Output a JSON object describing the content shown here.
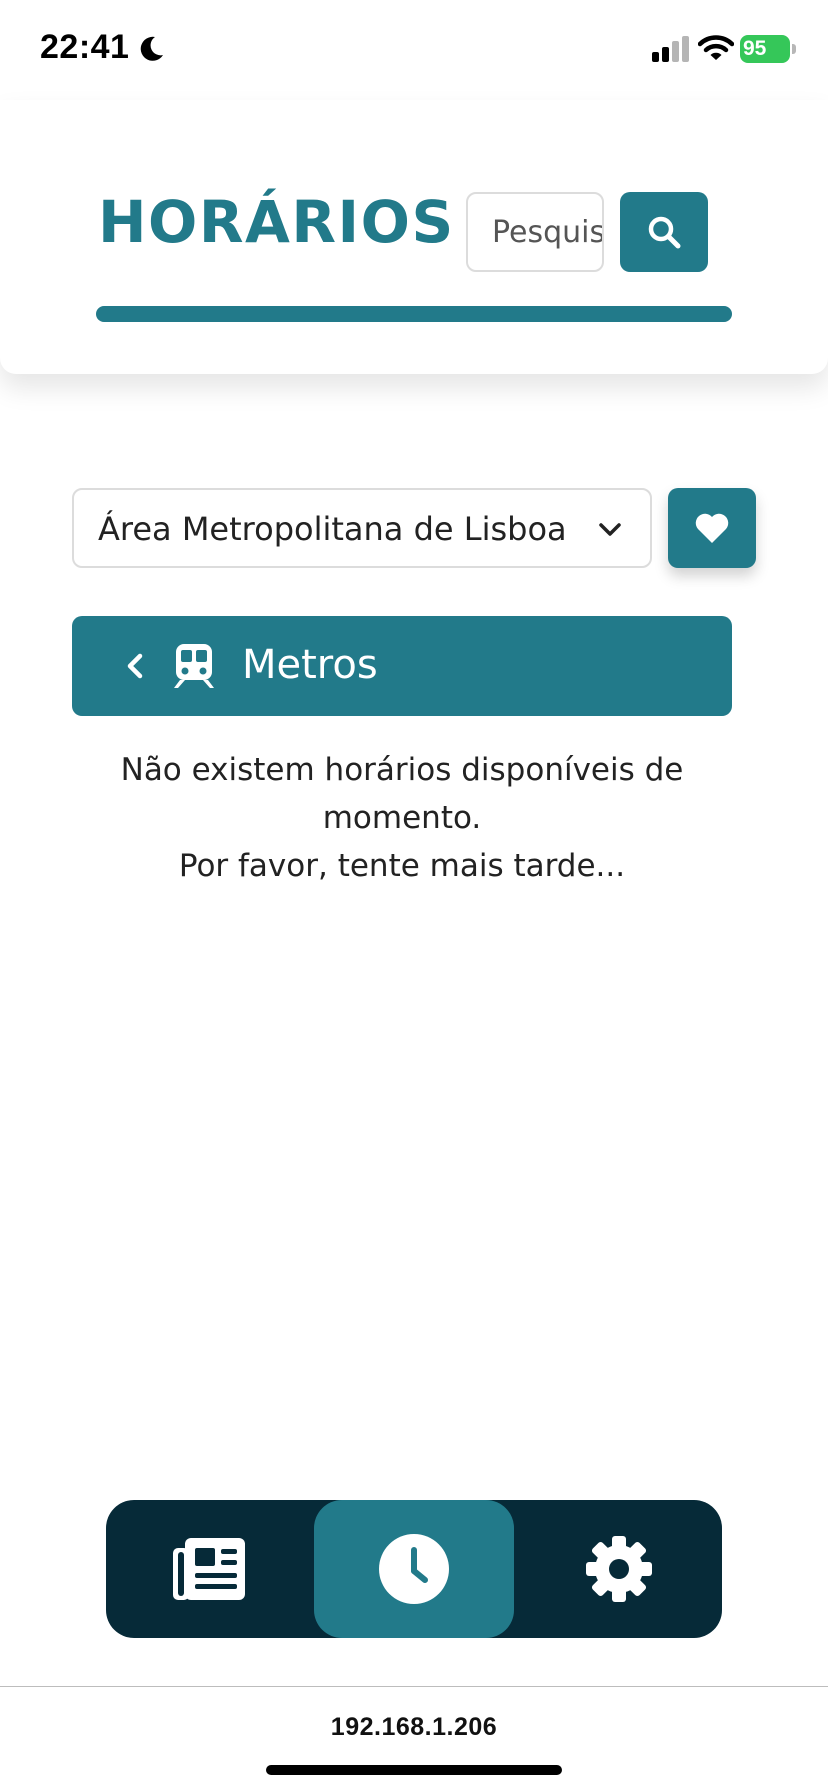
{
  "status_bar": {
    "time": "22:41",
    "battery": "95"
  },
  "header": {
    "title": "HORÁRIOS",
    "search_placeholder": "Pesquisar",
    "search_icon": "search-icon"
  },
  "region": {
    "selected": "Área Metropolitana de Lisboa",
    "favorite_icon": "heart-icon"
  },
  "category": {
    "label": "Metros",
    "back_icon": "chevron-left-icon",
    "icon": "train-icon"
  },
  "message": {
    "line1": "Não existem horários disponíveis de momento.",
    "line2": "Por favor, tente mais tarde..."
  },
  "bottom_nav": {
    "items": [
      {
        "icon": "newspaper-icon",
        "active": false
      },
      {
        "icon": "clock-icon",
        "active": true
      },
      {
        "icon": "gear-icon",
        "active": false
      }
    ]
  },
  "browser": {
    "url": "192.168.1.206"
  },
  "colors": {
    "primary": "#227a8a",
    "nav_background": "#062a38",
    "battery": "#35c759"
  }
}
